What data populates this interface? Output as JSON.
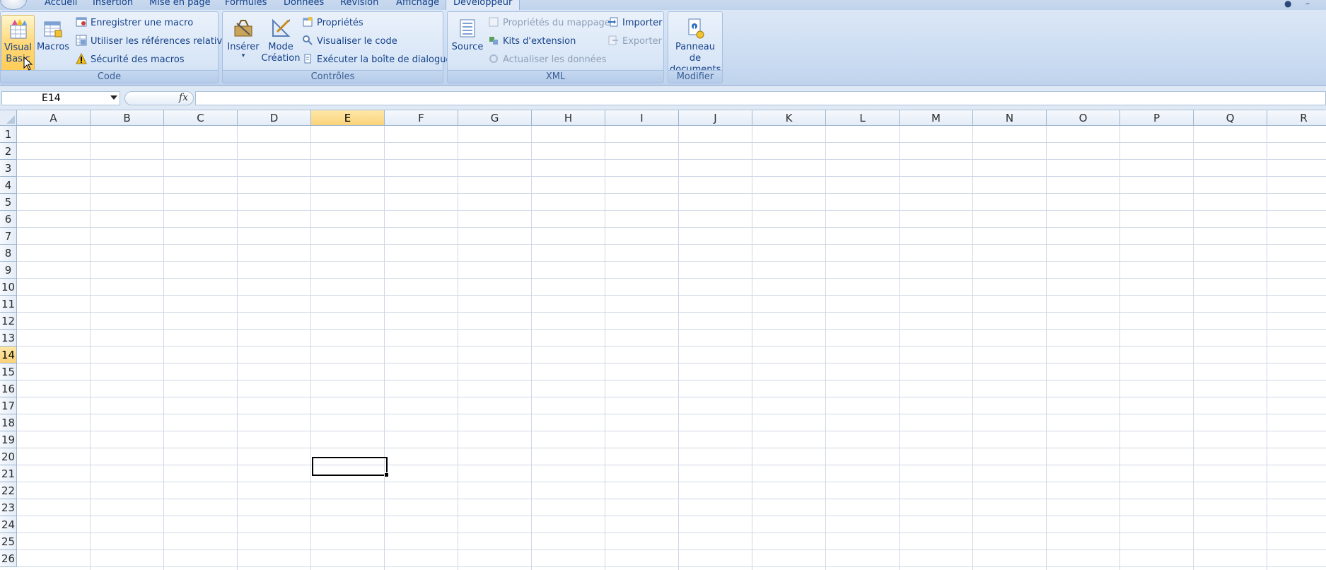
{
  "tabs": [
    "Accueil",
    "Insertion",
    "Mise en page",
    "Formules",
    "Données",
    "Révision",
    "Affichage",
    "Développeur"
  ],
  "active_tab": "Développeur",
  "ribbon": {
    "code": {
      "label": "Code",
      "visual_basic": "Visual\nBasic",
      "macros": "Macros",
      "record_macro": "Enregistrer une macro",
      "relative_refs": "Utiliser les références relatives",
      "macro_security": "Sécurité des macros"
    },
    "controls": {
      "label": "Contrôles",
      "insert": "Insérer",
      "design_mode": "Mode\nCréation",
      "properties": "Propriétés",
      "view_code": "Visualiser le code",
      "run_dialog": "Exécuter la boîte de dialogue"
    },
    "xml": {
      "label": "XML",
      "source": "Source",
      "map_properties": "Propriétés du mappage",
      "expansion_packs": "Kits d'extension",
      "refresh_data": "Actualiser les données",
      "import": "Importer",
      "export": "Exporter"
    },
    "modify": {
      "label": "Modifier",
      "document_panel": "Panneau de\ndocuments"
    }
  },
  "formula_bar": {
    "name_box": "E14",
    "fx": "fx",
    "formula": ""
  },
  "grid": {
    "columns": [
      "A",
      "B",
      "C",
      "D",
      "E",
      "F",
      "G",
      "H",
      "I",
      "J",
      "K",
      "L",
      "M",
      "N",
      "O",
      "P",
      "Q",
      "R"
    ],
    "rows": [
      "1",
      "2",
      "3",
      "4",
      "5",
      "6",
      "7",
      "8",
      "9",
      "10",
      "11",
      "12",
      "13",
      "14",
      "15",
      "16",
      "17",
      "18",
      "19",
      "20",
      "21",
      "22",
      "23",
      "24",
      "25",
      "26"
    ],
    "selected_column": "E",
    "selected_row": "14"
  },
  "colors": {
    "ribbon_blue": "#c9dbf1",
    "selected_header": "#f9d27a",
    "text_blue": "#15428b"
  }
}
